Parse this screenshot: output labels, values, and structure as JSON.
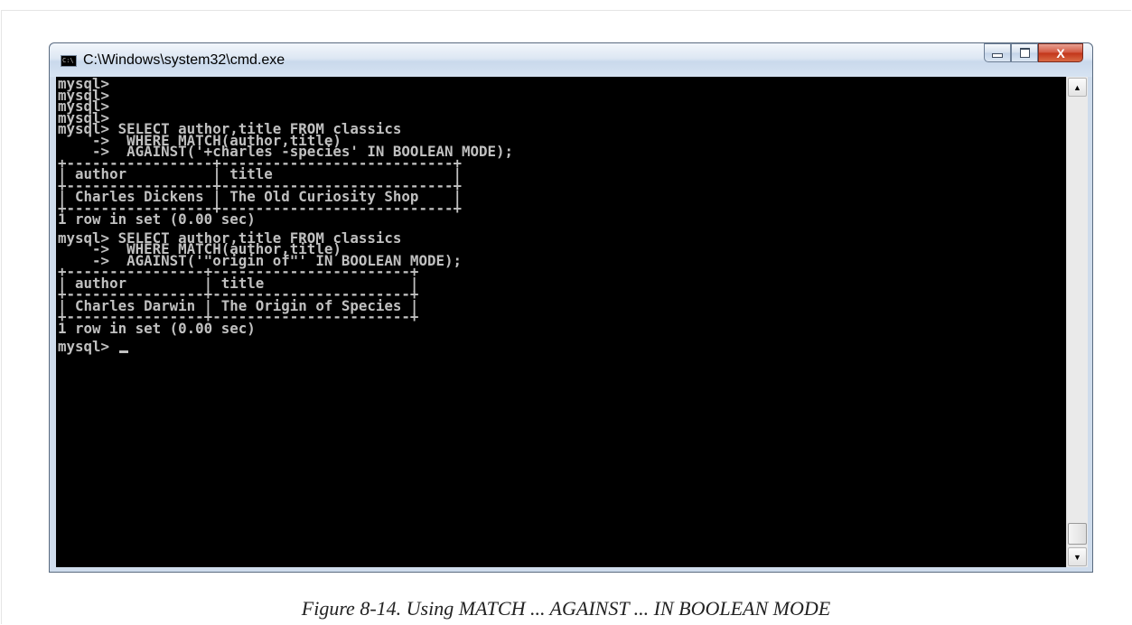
{
  "window": {
    "title": "C:\\Windows\\system32\\cmd.exe",
    "icon": "cmd-app-icon",
    "icon_text": "C:\\",
    "buttons": {
      "minimize": "minimize",
      "maximize": "maximize",
      "close": "X"
    }
  },
  "console": {
    "lines": [
      "mysql>",
      "mysql>",
      "mysql>",
      "mysql>",
      "mysql> SELECT author,title FROM classics",
      "    ->  WHERE MATCH(author,title)",
      "    ->  AGAINST('+charles -species' IN BOOLEAN MODE);",
      "+-----------------+---------------------------+",
      "| author          | title                     |",
      "+-----------------+---------------------------+",
      "| Charles Dickens | The Old Curiosity Shop    |",
      "+-----------------+---------------------------+",
      "1 row in set (0.00 sec)",
      "",
      "mysql> SELECT author,title FROM classics",
      "    ->  WHERE MATCH(author,title)",
      "    ->  AGAINST('\"origin of\"' IN BOOLEAN MODE);",
      "+----------------+-----------------------+",
      "| author         | title                 |",
      "+----------------+-----------------------+",
      "| Charles Darwin | The Origin of Species |",
      "+----------------+-----------------------+",
      "1 row in set (0.00 sec)",
      "",
      "mysql> "
    ]
  },
  "scrollbar": {
    "up_arrow": "▲",
    "down_arrow": "▼"
  },
  "figure_caption": "Figure 8-14. Using MATCH ... AGAINST ... IN BOOLEAN MODE"
}
